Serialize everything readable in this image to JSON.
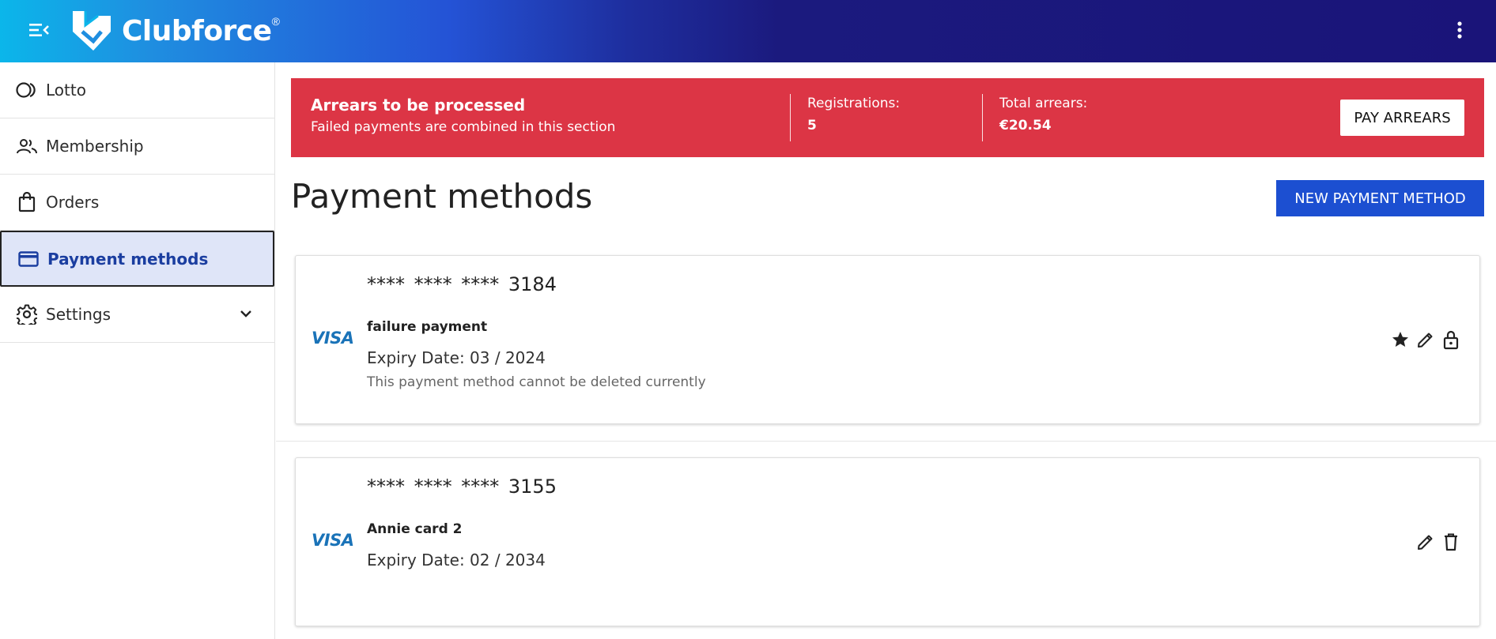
{
  "header": {
    "brand": "Clubforce",
    "brand_mark": "®",
    "menu_icon": "menu-collapse-icon",
    "more_icon": "more-vertical-icon"
  },
  "sidebar": {
    "items": [
      {
        "label": "Lotto",
        "icon": "lotto-icon"
      },
      {
        "label": "Membership",
        "icon": "people-icon"
      },
      {
        "label": "Orders",
        "icon": "shopping-bag-icon"
      },
      {
        "label": "Payment methods",
        "icon": "credit-card-icon",
        "active": true
      },
      {
        "label": "Settings",
        "icon": "gear-icon"
      }
    ]
  },
  "arrears": {
    "title": "Arrears to be processed",
    "subtitle": "Failed payments are combined in this section",
    "registrations_label": "Registrations:",
    "registrations_value": "5",
    "total_label": "Total arrears:",
    "total_value": "€20.54",
    "pay_button": "PAY ARREARS",
    "color": "#dc3545"
  },
  "main": {
    "title": "Payment methods",
    "new_button": "NEW PAYMENT METHOD",
    "accent": "#1c4fd1"
  },
  "cards": [
    {
      "brand": "VISA",
      "number": "**** **** **** 3184",
      "name": "failure payment",
      "expiry": "Expiry Date: 03 / 2024",
      "note": "This payment method cannot be deleted currently",
      "actions": [
        "star-icon",
        "pencil-icon",
        "lock-icon"
      ]
    },
    {
      "brand": "VISA",
      "number": "**** **** **** 3155",
      "name": "Annie card 2",
      "expiry": "Expiry Date: 02 / 2034",
      "actions": [
        "pencil-icon",
        "trash-icon"
      ]
    }
  ]
}
